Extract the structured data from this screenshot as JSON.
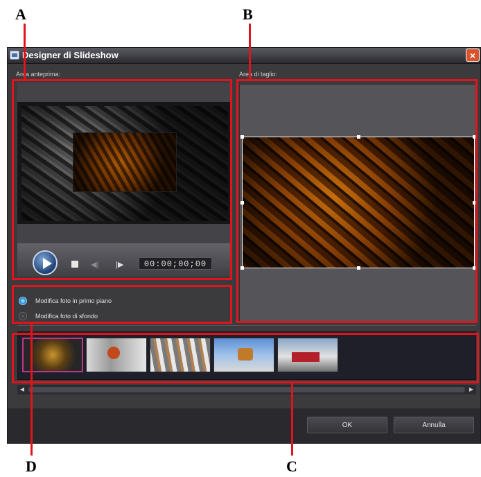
{
  "callouts": {
    "a": "A",
    "b": "B",
    "c": "C",
    "d": "D"
  },
  "window": {
    "title": "Designer di Slideshow",
    "close_label": "×"
  },
  "preview": {
    "label": "Area anteprima:",
    "timecode": "00:00;00;00",
    "icons": [
      "play-icon",
      "stop-icon",
      "previous-frame-icon",
      "next-frame-icon"
    ]
  },
  "crop": {
    "label": "Area di taglio:"
  },
  "photo_mode": {
    "options": [
      {
        "label": "Modifica foto in primo piano",
        "selected": true
      },
      {
        "label": "Modifica foto di sfondo",
        "selected": false
      }
    ]
  },
  "filmstrip": {
    "thumbnail_count": 5,
    "selected_index": 0
  },
  "buttons": {
    "ok": "OK",
    "cancel": "Annulla"
  },
  "colors": {
    "callout": "#e0141a",
    "dialog_bg": "#3b3b3e",
    "selected_thumb_border": "#c0368a",
    "radio_selected": "#2f95dd"
  }
}
